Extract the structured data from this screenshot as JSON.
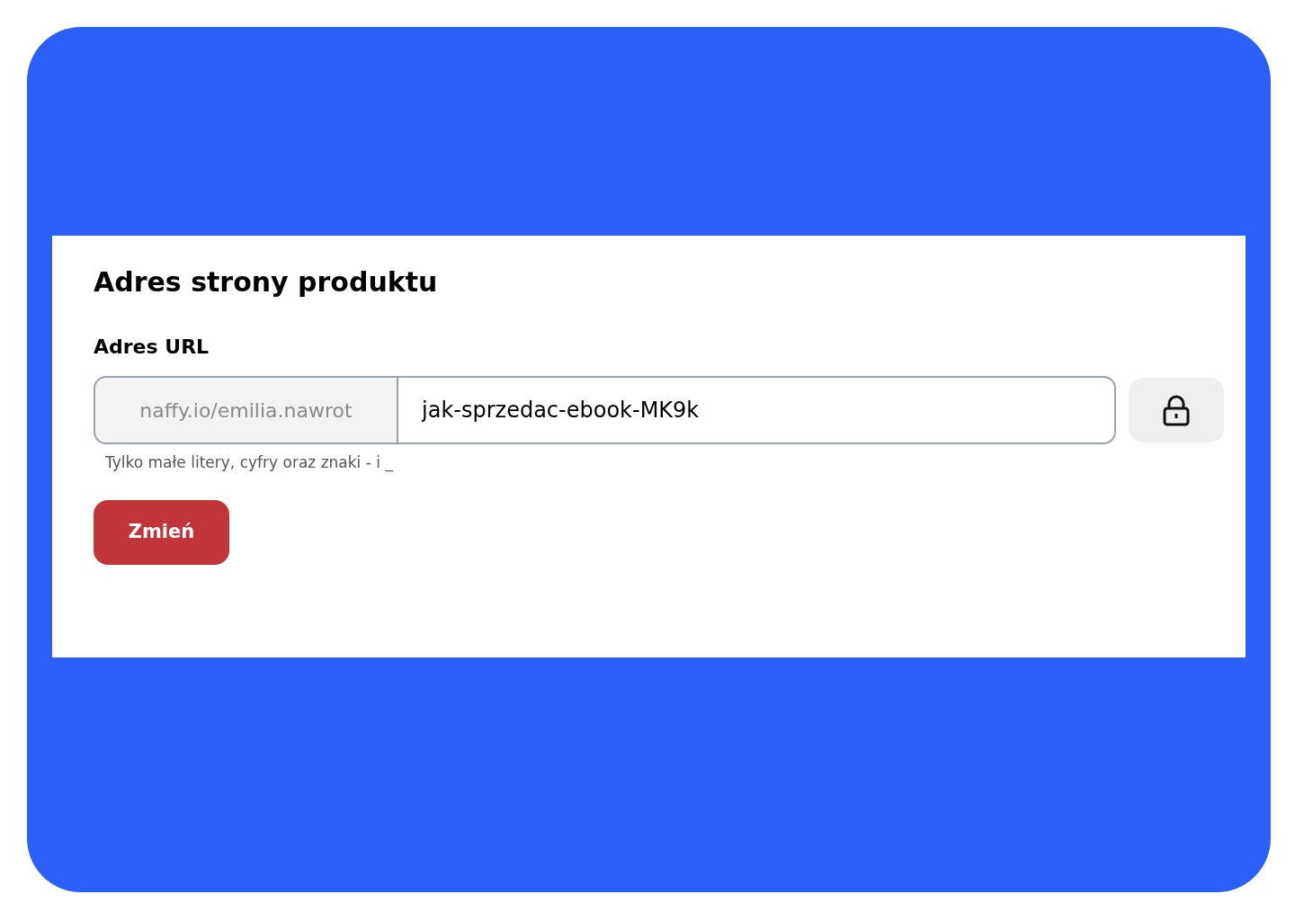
{
  "section": {
    "title": "Adres strony produktu"
  },
  "url_field": {
    "label": "Adres URL",
    "prefix": "naffy.io/emilia.nawrot",
    "value": "jak-sprzedac-ebook-MK9k",
    "hint": "Tylko małe litery, cyfry oraz znaki - i _"
  },
  "buttons": [
    "Zmień"
  ]
}
